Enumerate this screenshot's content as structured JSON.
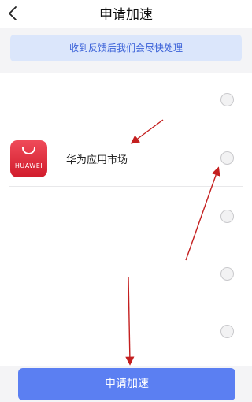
{
  "header": {
    "title": "申请加速",
    "back_icon": "chevron-left-icon"
  },
  "notice": {
    "text": "收到反馈后我们会尽快处理"
  },
  "apps": [
    {
      "name": "",
      "selected": false
    },
    {
      "name": "华为应用市场",
      "icon": "huawei-appgallery-icon",
      "icon_text": "HUAWEI",
      "selected": false
    },
    {
      "name": "",
      "selected": false
    },
    {
      "name": "",
      "selected": false
    },
    {
      "name": "",
      "selected": false
    }
  ],
  "submit": {
    "label": "申请加速"
  },
  "colors": {
    "accent": "#5b7ff2",
    "notice_bg": "#dbe6fb",
    "notice_text": "#3a61d8",
    "annotation_arrow": "#c41f1f"
  }
}
